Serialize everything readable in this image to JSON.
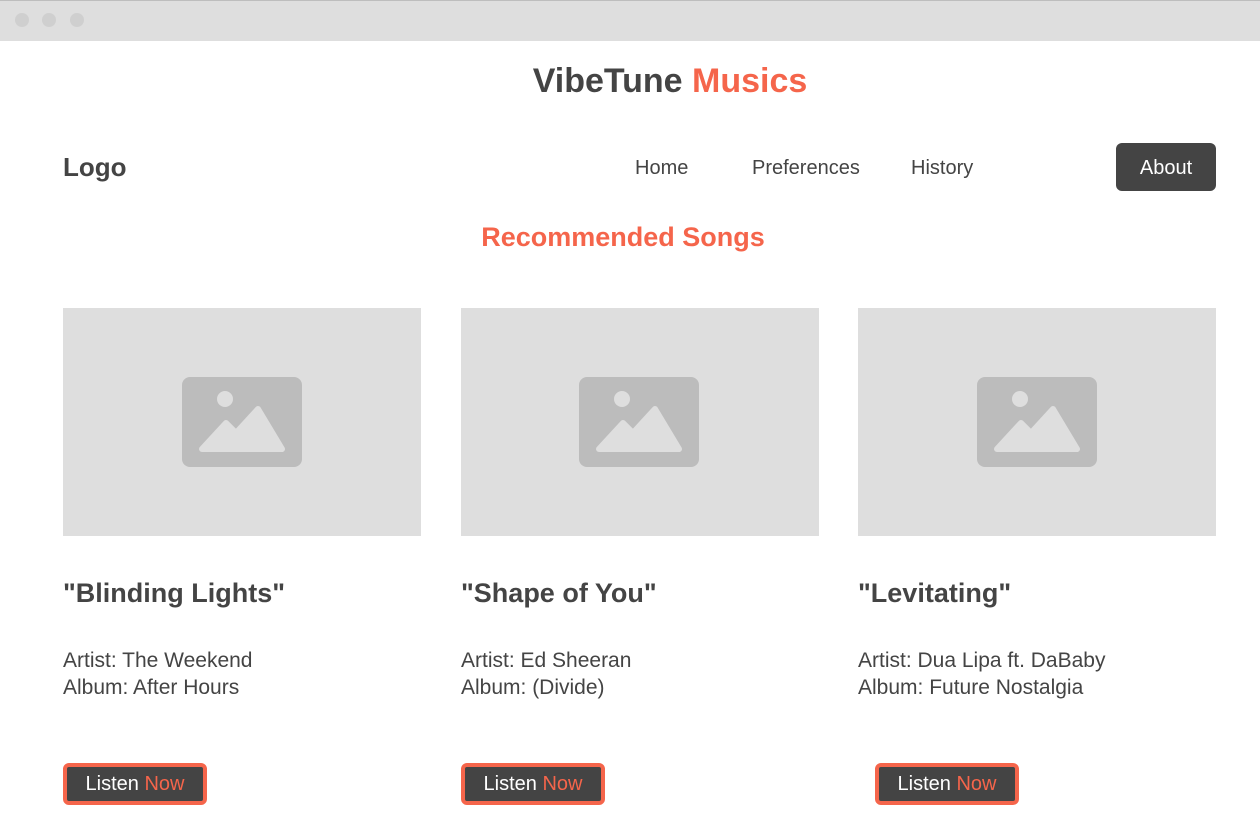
{
  "header": {
    "title_part1": "VibeTune",
    "title_part2": "Musics",
    "logo": "Logo"
  },
  "nav": {
    "home": "Home",
    "preferences": "Preferences",
    "history": "History",
    "about": "About"
  },
  "section_title": "Recommended Songs",
  "songs": [
    {
      "title": "\"Blinding Lights\"",
      "artist": "Artist: The Weekend",
      "album": "Album: After Hours",
      "button_part1": "Listen",
      "button_part2": "Now",
      "image_icon": "image-placeholder-icon"
    },
    {
      "title": "\"Shape of You\"",
      "artist": "Artist: Ed Sheeran",
      "album": "Album: (Divide)",
      "button_part1": "Listen",
      "button_part2": "Now",
      "image_icon": "image-placeholder-icon"
    },
    {
      "title": "\"Levitating\"",
      "artist": "Artist: Dua Lipa ft. DaBaby",
      "album": "Album: Future Nostalgia",
      "button_part1": "Listen",
      "button_part2": "Now",
      "image_icon": "image-placeholder-icon"
    }
  ],
  "colors": {
    "accent": "#f5654b",
    "dark": "#444444",
    "placeholder_bg": "#dedede",
    "placeholder_icon": "#bcbcbc"
  }
}
